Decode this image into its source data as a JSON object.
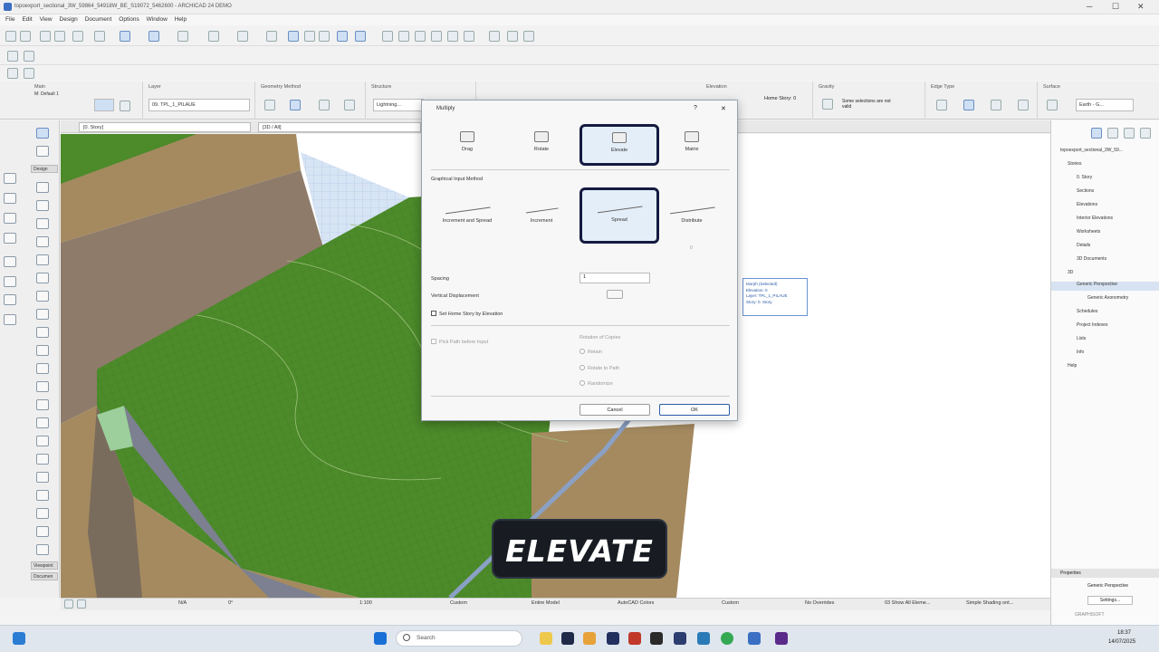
{
  "window": {
    "title": "topoexport_sectional_3W_59864_54918W_BE_S19072_5462600 - ARCHICAD 24 DEMO",
    "controls": [
      "─",
      "☐",
      "✕"
    ]
  },
  "menu": [
    "File",
    "Edit",
    "View",
    "Design",
    "Document",
    "Options",
    "Window",
    "Help"
  ],
  "infobox": {
    "groups": [
      {
        "label": "Main",
        "value": "M: Default 1"
      },
      {
        "label": "Layer",
        "value": "09. TPL_1_PILAUE"
      },
      {
        "label": "Geometry Method",
        "value": ""
      },
      {
        "label": "Structure",
        "value": "Lightning..."
      },
      {
        "label": "Elevation",
        "value": "Home Story: 0"
      },
      {
        "label": "Gravity",
        "value": "Some selections are not valid"
      },
      {
        "label": "Edge Type",
        "value": ""
      },
      {
        "label": "Surface",
        "value": "Earth - G..."
      }
    ]
  },
  "left_tabs": {
    "design": "Design",
    "viewpoints": "Viewpoint",
    "document": "Documen"
  },
  "tabs": {
    "floorplan": "[0. Story]",
    "view3d": "[3D / All]"
  },
  "navigator": {
    "root": "topoexport_sectional_3W_59...",
    "items": [
      "Stories",
      "0. Story",
      "Sections",
      "Elevations",
      "Interior Elevations",
      "Worksheets",
      "Details",
      "3D Documents",
      "3D",
      "Generic Perspective",
      "Generic Axonometry",
      "Schedules",
      "Project Indexes",
      "Lists",
      "Info",
      "Help"
    ],
    "selected": "Generic Perspective",
    "properties_label": "Properties",
    "properties_value": "Generic Perspective",
    "settings_button": "Settings...",
    "brand": "GRAPHISOFT"
  },
  "dialog": {
    "title": "Multiply",
    "help": "?",
    "close": "✕",
    "modes": [
      "Drag",
      "Rotate",
      "Elevate",
      "Matrix"
    ],
    "selected_mode": "Elevate",
    "method_header": "Graphical Input Method",
    "methods": [
      "Increment and Spread",
      "Increment",
      "Spread",
      "Distribute"
    ],
    "selected_method": "Spread",
    "distribute_value": "0",
    "spacing_label": "Spacing",
    "spacing_value": "1",
    "vertical_label": "Vertical Displacement",
    "set_home_story": "Set Home Story by Elevation",
    "pick_path": "Pick Path before Input",
    "rotation_header": "Rotation of Copies",
    "rotation_options": [
      "Retain",
      "Rotate to Path",
      "Randomize"
    ],
    "cancel": "Cancel",
    "ok": "OK"
  },
  "tooltip": [
    "Morph (Selected)",
    "Elevation: 0",
    "Layer: TPL_1_PILAUE",
    "Story: 0. Story"
  ],
  "overlay_caption": "ELEVATE",
  "status": {
    "zoom": "N/A",
    "angle": "0°",
    "scale": "1:100",
    "pen": "Custom",
    "model": "Entire Model",
    "colors": "AutoCAD Colors",
    "structure": "Custom",
    "overrides": "No Overrides",
    "show": "03 Show All Eleme...",
    "shading": "Simple Shading ont..."
  },
  "taskbar": {
    "search": "Search",
    "time": "18:37",
    "date": "14/07/2025"
  },
  "colors": {
    "accent": "#151a40",
    "terrain": "#4c8a2a",
    "earth": "#a58a60"
  }
}
